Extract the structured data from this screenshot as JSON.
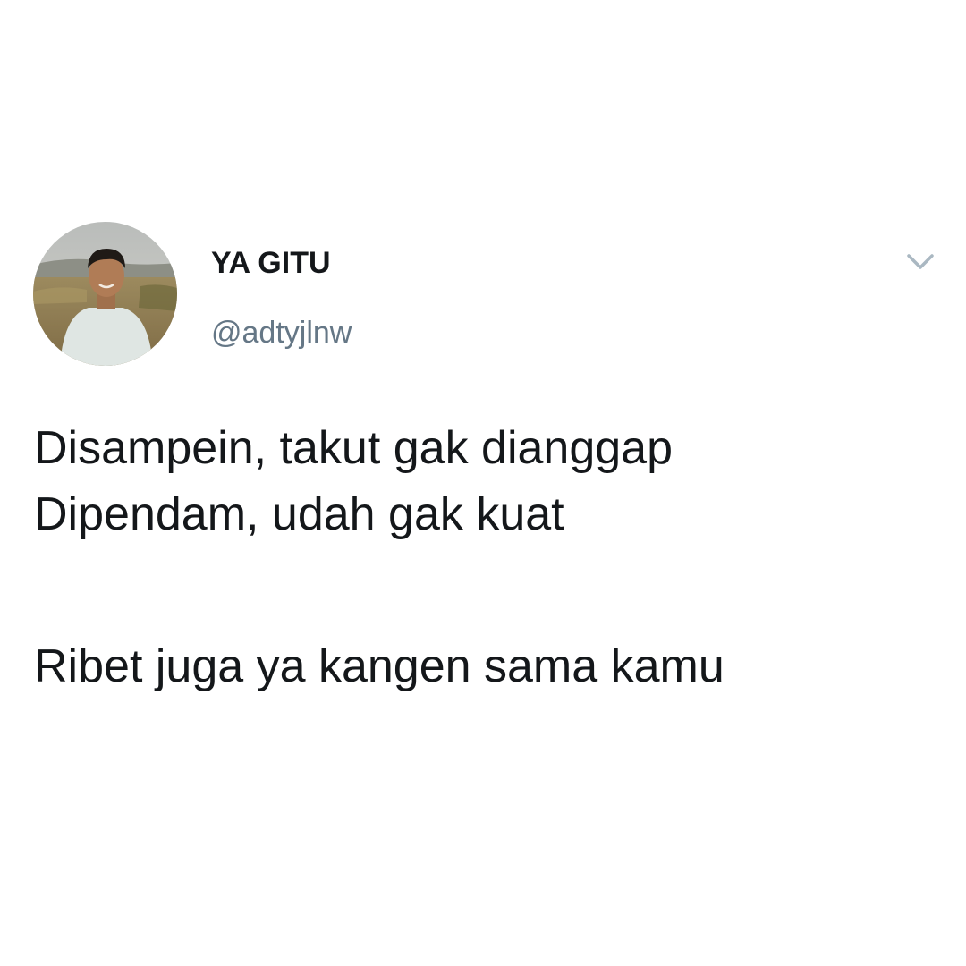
{
  "tweet": {
    "author": {
      "display_name": "YA GITU",
      "handle": "@adtyjlnw",
      "avatar_icon": "profile-photo"
    },
    "more_icon": "chevron-down-icon",
    "lines": [
      "Disampein, takut gak dianggap",
      "Dipendam, udah gak kuat",
      "Ribet juga ya kangen sama kamu"
    ]
  },
  "colors": {
    "background": "#ffffff",
    "text_primary": "#14171a",
    "text_secondary": "#657786",
    "icon": "#aab8c2"
  }
}
